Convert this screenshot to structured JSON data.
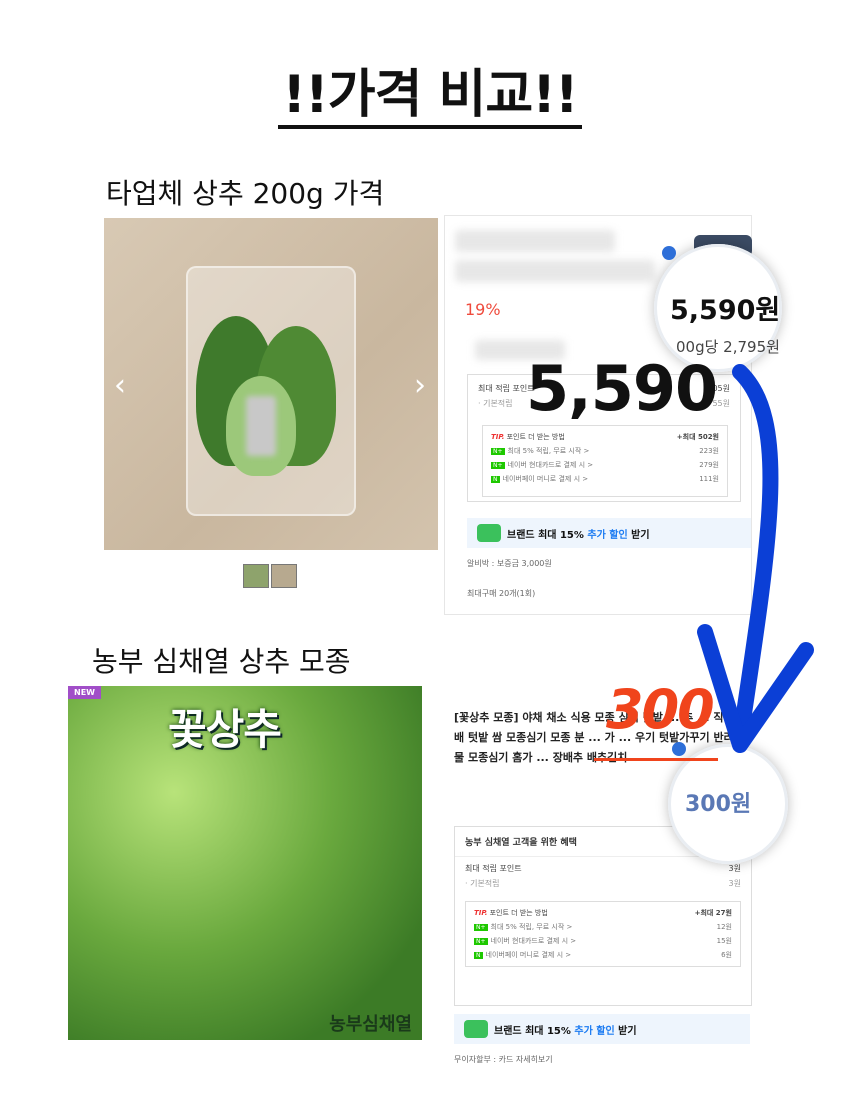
{
  "title": "!!가격 비교!!",
  "product1": {
    "label": "타업체 상추 200g 가격",
    "discount": "19%",
    "circle_price": "5,590원",
    "unit_price": "00g당 2,795원",
    "overlay_price": "5,590",
    "points": {
      "title": "최대 적립 포인트",
      "value": "05원",
      "basic_label": "· 기본적립",
      "basic_value": "55원",
      "tip_label": "TIP.",
      "tip_title": "포인트 더 받는 방법",
      "tip_max": "+최대 502원",
      "rows": [
        {
          "text": "최대 5% 적립, 무료 시작 >",
          "value": "223원"
        },
        {
          "text": "네이버 현대카드로 결제 시 >",
          "value": "279원"
        },
        {
          "text": "네이버페이 머니로 결제 시 >",
          "value": "111원"
        }
      ]
    },
    "brand_bar": {
      "pre": "브랜드 최대 15%",
      "accent": "추가 할인",
      "post": "받기"
    },
    "deposit": "알비박 : 보증금 3,000원",
    "max_order": "최대구매 20개(1회)"
  },
  "product2": {
    "label": "농부 심채열 상추 모종",
    "image_title": "꽃상추",
    "new_badge": "NEW",
    "signature": "농부심채열",
    "desc": "[꽃상추 모종] 야채 채소 식용 모종 심기 텃밭 ... 추 ... 직접재배 텃밭 쌈 모종심기 모종 분 ... 가 ... 우기 텃밭가꾸기 반려식물 모종심기 홈가 ... 장배추 배추김치",
    "circle_price": "300원",
    "overlay_price": "300",
    "benefit_title": "농부 심채열 고객을 위한 혜택",
    "points": {
      "title": "최대 적립 포인트",
      "value": "3원",
      "basic_label": "· 기본적립",
      "basic_value": "3원",
      "tip_label": "TIP.",
      "tip_title": "포인트 더 받는 방법",
      "tip_max": "+최대 27원",
      "rows": [
        {
          "text": "최대 5% 적립, 무료 시작 >",
          "value": "12원"
        },
        {
          "text": "네이버 현대카드로 결제 시 >",
          "value": "15원"
        },
        {
          "text": "네이버페이 머니로 결제 시 >",
          "value": "6원"
        }
      ]
    },
    "brand_bar": {
      "pre": "브랜드 최대 15%",
      "accent": "추가 할인",
      "post": "받기"
    },
    "installment": "무이자할부 : 카드 자세히보기"
  },
  "colors": {
    "accent_red": "#f0441c",
    "arrow_blue": "#0b3fd6",
    "link_blue": "#1b7bf2"
  }
}
